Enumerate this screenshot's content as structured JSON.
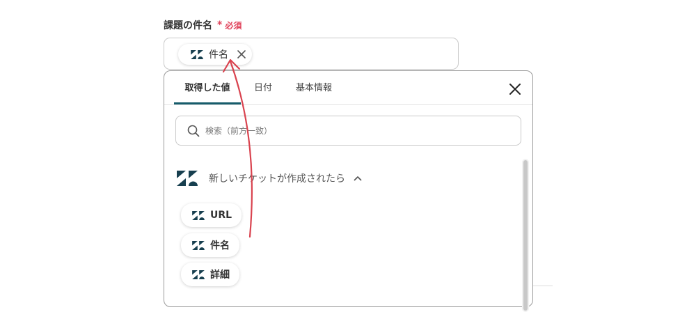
{
  "field": {
    "label": "課題の件名",
    "required_mark": "*",
    "required_text": "必須"
  },
  "input": {
    "chip_label": "件名"
  },
  "popup": {
    "tabs": [
      {
        "label": "取得した値",
        "active": true
      },
      {
        "label": "日付",
        "active": false
      },
      {
        "label": "基本情報",
        "active": false
      }
    ],
    "search_placeholder": "検索（前方一致）",
    "section_title": "新しいチケットが作成されたら",
    "items": [
      {
        "label": "URL"
      },
      {
        "label": "件名"
      },
      {
        "label": "詳細"
      }
    ]
  },
  "icons": {
    "app_logo": "zendesk-logo-icon",
    "close": "close-icon",
    "search": "search-icon",
    "chevron": "chevron-up-icon"
  },
  "colors": {
    "logo": "#173f4f",
    "active_tab_underline": "#165c6b",
    "required": "#e0445c",
    "annotation_arrow": "#d9434f"
  }
}
